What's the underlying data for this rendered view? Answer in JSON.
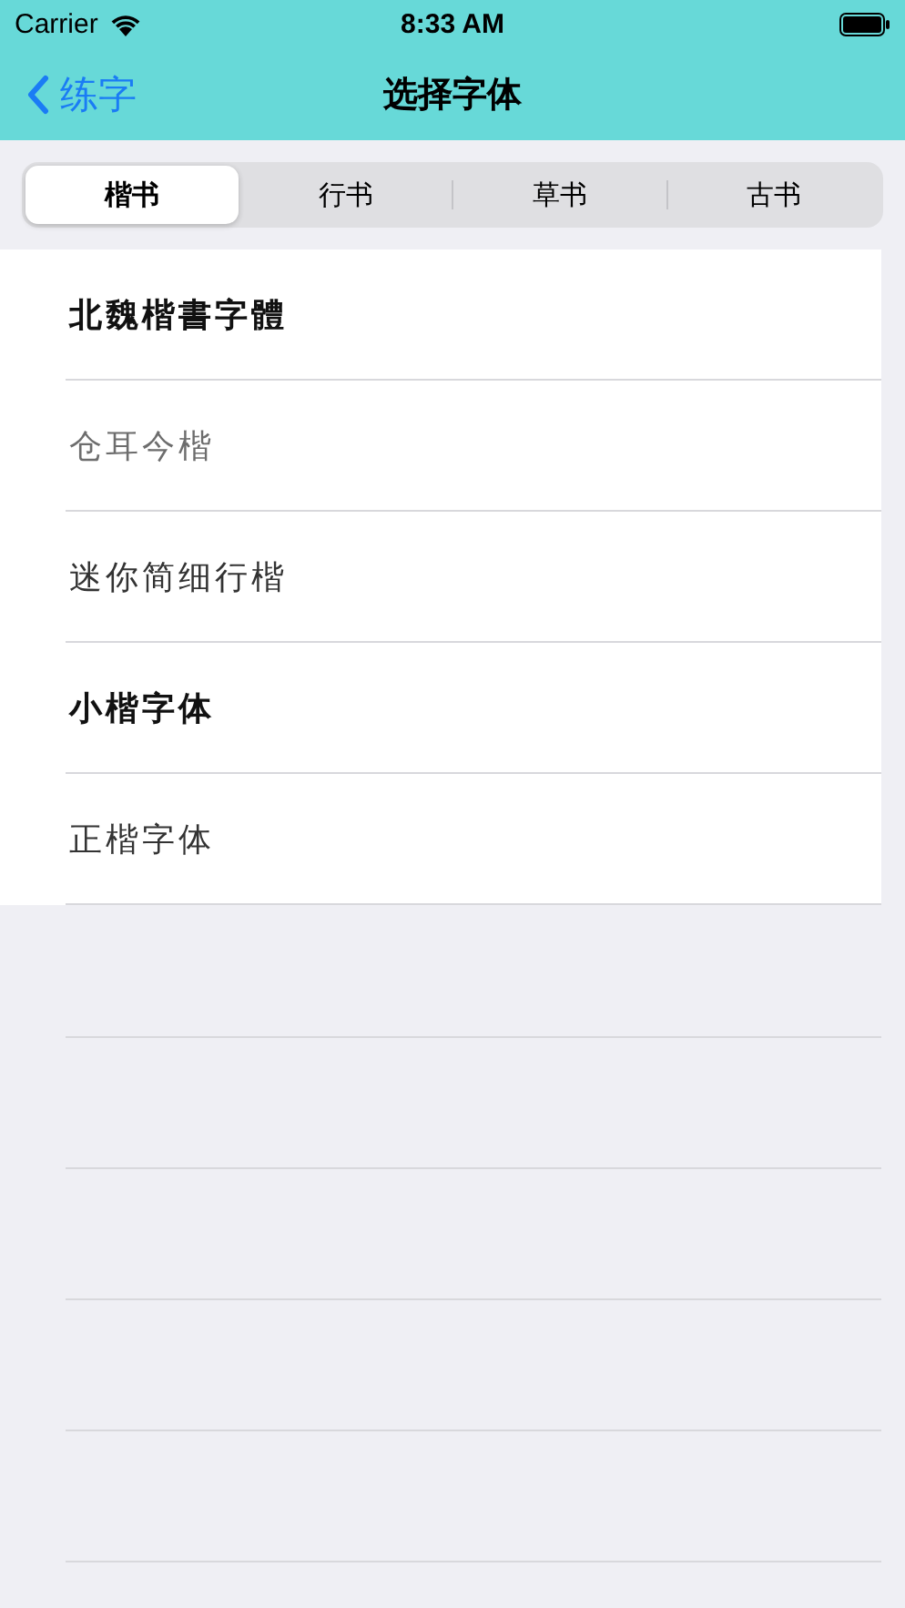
{
  "status_bar": {
    "carrier": "Carrier",
    "time": "8:33 AM"
  },
  "nav_bar": {
    "back_label": "练字",
    "title": "选择字体"
  },
  "tabs": [
    {
      "label": "楷书",
      "selected": true
    },
    {
      "label": "行书",
      "selected": false
    },
    {
      "label": "草书",
      "selected": false
    },
    {
      "label": "古书",
      "selected": false
    }
  ],
  "fonts": [
    {
      "name": "北魏楷書字體",
      "kind": "bold"
    },
    {
      "name": "仓耳今楷",
      "kind": "light"
    },
    {
      "name": "迷你简细行楷",
      "kind": "regular"
    },
    {
      "name": "小楷字体",
      "kind": "bold"
    },
    {
      "name": "正楷字体",
      "kind": "regular"
    }
  ]
}
